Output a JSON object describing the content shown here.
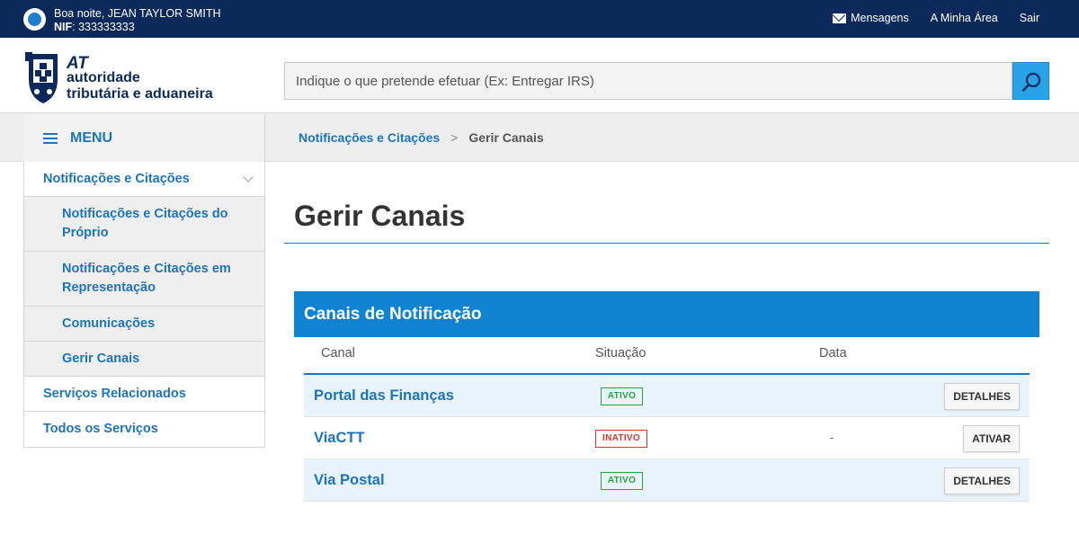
{
  "topbar": {
    "greeting": "Boa noite, JEAN TAYLOR SMITH",
    "nif_label": "NIF",
    "nif_value": ": 333333333",
    "links": [
      "Mensagens",
      "A Minha Área",
      "Sair"
    ]
  },
  "header": {
    "logo_at": "AT",
    "logo_line1": "autoridade",
    "logo_line2": "tributária e aduaneira",
    "search_placeholder": "Indique o que pretende efetuar (Ex: Entregar IRS)"
  },
  "menu_label": "MENU",
  "breadcrumb": [
    "Notificações e Citações",
    ">",
    "Gerir Canais"
  ],
  "sidebar": {
    "items": [
      "Notificações e Citações",
      "Notificações e Citações do Próprio",
      "Notificações e Citações em Representação",
      "Comunicações",
      "Gerir Canais",
      "Serviços Relacionados",
      "Todos os Serviços"
    ]
  },
  "page_title": "Gerir Canais",
  "panel": {
    "title": "Canais de Notificação",
    "columns": [
      "Canal",
      "Situação",
      "Data"
    ],
    "rows": [
      {
        "canal": "Portal das Finanças",
        "situacao": "ATIVO",
        "data": "",
        "action": "DETALHES"
      },
      {
        "canal": "ViaCTT",
        "situacao": "INATIVO",
        "data": "-",
        "action": "ATIVAR"
      },
      {
        "canal": "Via Postal",
        "situacao": "ATIVO",
        "data": "",
        "action": "DETALHES"
      }
    ]
  },
  "colors": {
    "topbar": "#0b2a5b",
    "accent": "#1e73be",
    "panel_header": "#0f83d0",
    "active": "#2aa33a",
    "inactive": "#d9342b"
  }
}
